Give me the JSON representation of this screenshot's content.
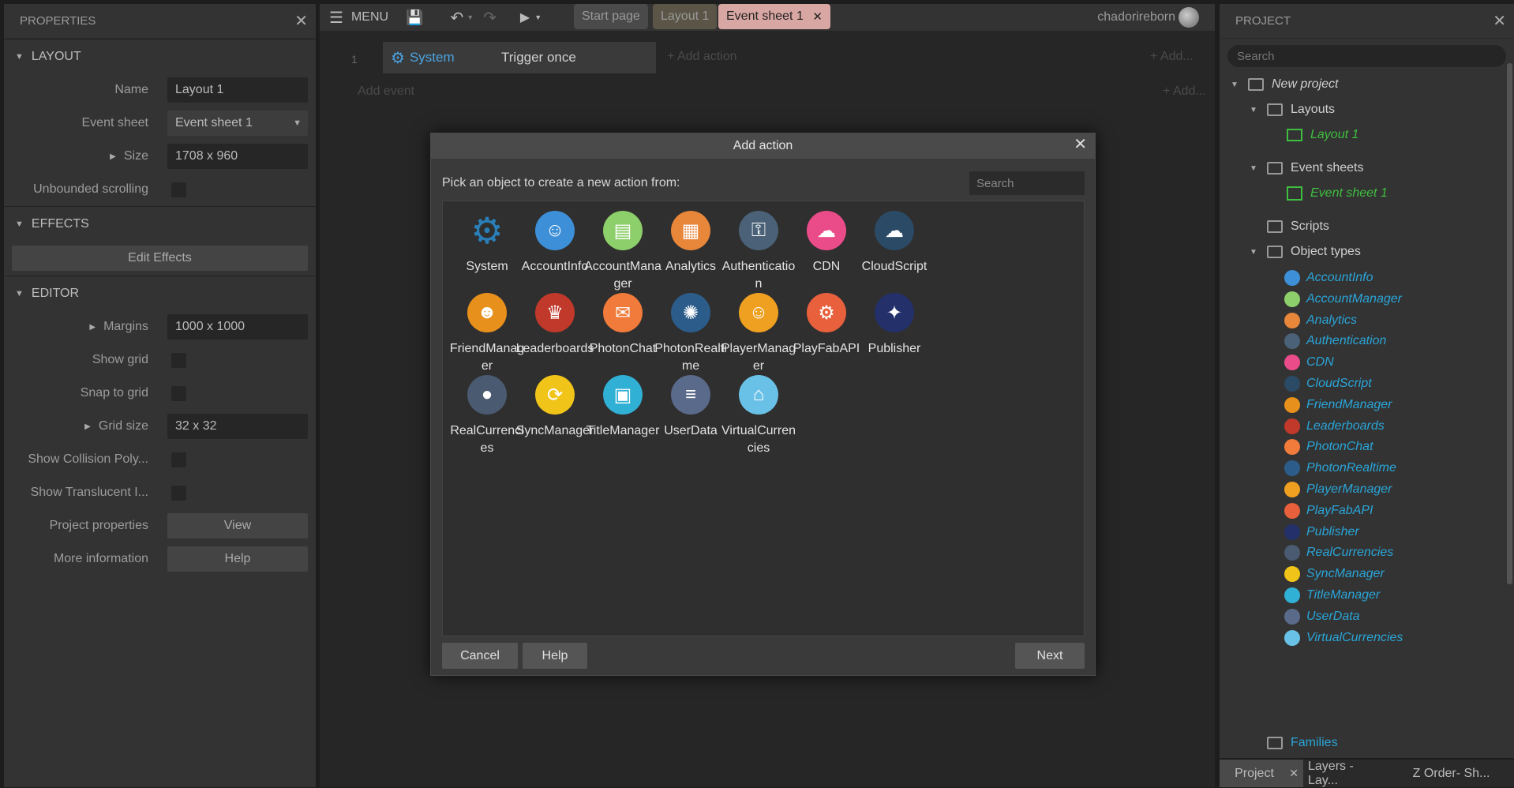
{
  "properties": {
    "title": "PROPERTIES",
    "layout_section": "LAYOUT",
    "name_label": "Name",
    "name_value": "Layout 1",
    "eventsheet_label": "Event sheet",
    "eventsheet_value": "Event sheet 1",
    "size_label": "Size",
    "size_value": "1708 x 960",
    "unbounded_label": "Unbounded scrolling",
    "effects_section": "EFFECTS",
    "edit_effects": "Edit Effects",
    "editor_section": "EDITOR",
    "margins_label": "Margins",
    "margins_value": "1000 x 1000",
    "showgrid_label": "Show grid",
    "snap_label": "Snap to grid",
    "gridsize_label": "Grid size",
    "gridsize_value": "32 x 32",
    "collision_label": "Show Collision Poly...",
    "translucent_label": "Show Translucent I...",
    "projprops_label": "Project properties",
    "projprops_btn": "View",
    "moreinfo_label": "More information",
    "moreinfo_btn": "Help"
  },
  "toolbar": {
    "menu": "MENU",
    "tabs": [
      "Start page",
      "Layout 1",
      "Event sheet 1"
    ],
    "user": "chadorireborn"
  },
  "eventsheet": {
    "num": "1",
    "system": "System",
    "trigger": "Trigger once",
    "add_action": "+ Add action",
    "add_event": "Add event",
    "add1": "+ Add...",
    "add2": "+ Add..."
  },
  "dialog": {
    "title": "Add action",
    "prompt": "Pick an object to create a new action from:",
    "search_placeholder": "Search",
    "items": [
      {
        "name": "System",
        "color": "#2a7fb8",
        "icon": "gear-icon"
      },
      {
        "name": "AccountInfo",
        "color": "#3d8fd8",
        "icon": "account-icon"
      },
      {
        "name": "AccountManager",
        "color": "#8dcf6a",
        "icon": "clipboard-icon"
      },
      {
        "name": "Analytics",
        "color": "#e8863a",
        "icon": "report-icon"
      },
      {
        "name": "Authentication",
        "color": "#4a6178",
        "icon": "user-lock-icon"
      },
      {
        "name": "CDN",
        "color": "#ea4c89",
        "icon": "cloud-icon"
      },
      {
        "name": "CloudScript",
        "color": "#2b4a66",
        "icon": "cloud-network-icon"
      },
      {
        "name": "FriendManager",
        "color": "#e8901c",
        "icon": "friends-icon"
      },
      {
        "name": "Leaderboards",
        "color": "#c0392b",
        "icon": "trophy-icon"
      },
      {
        "name": "PhotonChat",
        "color": "#f07b3a",
        "icon": "chat-icon"
      },
      {
        "name": "PhotonRealtime",
        "color": "#2c5d8a",
        "icon": "signal-icon"
      },
      {
        "name": "PlayerManager",
        "color": "#f0a020",
        "icon": "player-icon"
      },
      {
        "name": "PlayFabAPI",
        "color": "#e8603c",
        "icon": "api-icon"
      },
      {
        "name": "Publisher",
        "color": "#24306a",
        "icon": "network-icon"
      },
      {
        "name": "RealCurrencies",
        "color": "#4a5a70",
        "icon": "coin-icon"
      },
      {
        "name": "SyncManager",
        "color": "#f0c419",
        "icon": "sync-icon"
      },
      {
        "name": "TitleManager",
        "color": "#31b0d5",
        "icon": "monitor-icon"
      },
      {
        "name": "UserData",
        "color": "#5a6a8a",
        "icon": "database-icon"
      },
      {
        "name": "VirtualCurrencies",
        "color": "#6ac1e8",
        "icon": "store-icon"
      }
    ],
    "cancel": "Cancel",
    "help": "Help",
    "next": "Next"
  },
  "project": {
    "title": "PROJECT",
    "search_placeholder": "Search",
    "root": "New project",
    "layouts": "Layouts",
    "layout1": "Layout 1",
    "eventsheets": "Event sheets",
    "eventsheet1": "Event sheet 1",
    "scripts": "Scripts",
    "objecttypes": "Object types",
    "objects": [
      "AccountInfo",
      "AccountManager",
      "Analytics",
      "Authentication",
      "CDN",
      "CloudScript",
      "FriendManager",
      "Leaderboards",
      "PhotonChat",
      "PhotonRealtime",
      "PlayerManager",
      "PlayFabAPI",
      "Publisher",
      "RealCurrencies",
      "SyncManager",
      "TitleManager",
      "UserData",
      "VirtualCurrencies"
    ],
    "families": "Families"
  },
  "bottom_tabs": [
    "Project",
    "Layers - Lay...",
    "Z Order- Sh..."
  ]
}
